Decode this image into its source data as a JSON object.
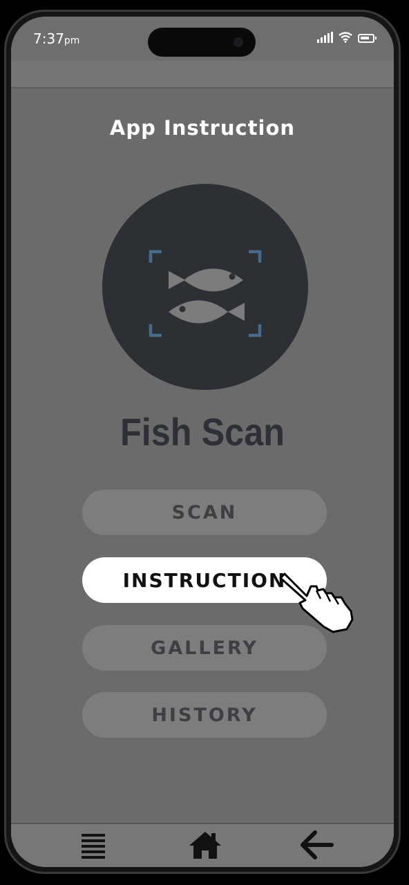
{
  "status_bar": {
    "time": "7:37",
    "ampm": "pm"
  },
  "header": {
    "title": "App Instruction"
  },
  "app": {
    "name": "Fish Scan",
    "logo_icon": "fish-scan-icon"
  },
  "menu": {
    "items": [
      {
        "label": "SCAN",
        "active": false
      },
      {
        "label": "INSTRUCTION",
        "active": true
      },
      {
        "label": "GALLERY",
        "active": false
      },
      {
        "label": "HISTORY",
        "active": false
      }
    ]
  },
  "bottom_nav": {
    "items": [
      {
        "icon": "menu-icon"
      },
      {
        "icon": "home-icon"
      },
      {
        "icon": "back-arrow-icon"
      }
    ]
  },
  "colors": {
    "screen_overlay": "#6b6b6b",
    "logo_bg": "#2c2f33",
    "accent_blue": "#4a6a8a",
    "active_button_bg": "#ffffff",
    "inactive_button_bg": "#7d7d7d"
  }
}
